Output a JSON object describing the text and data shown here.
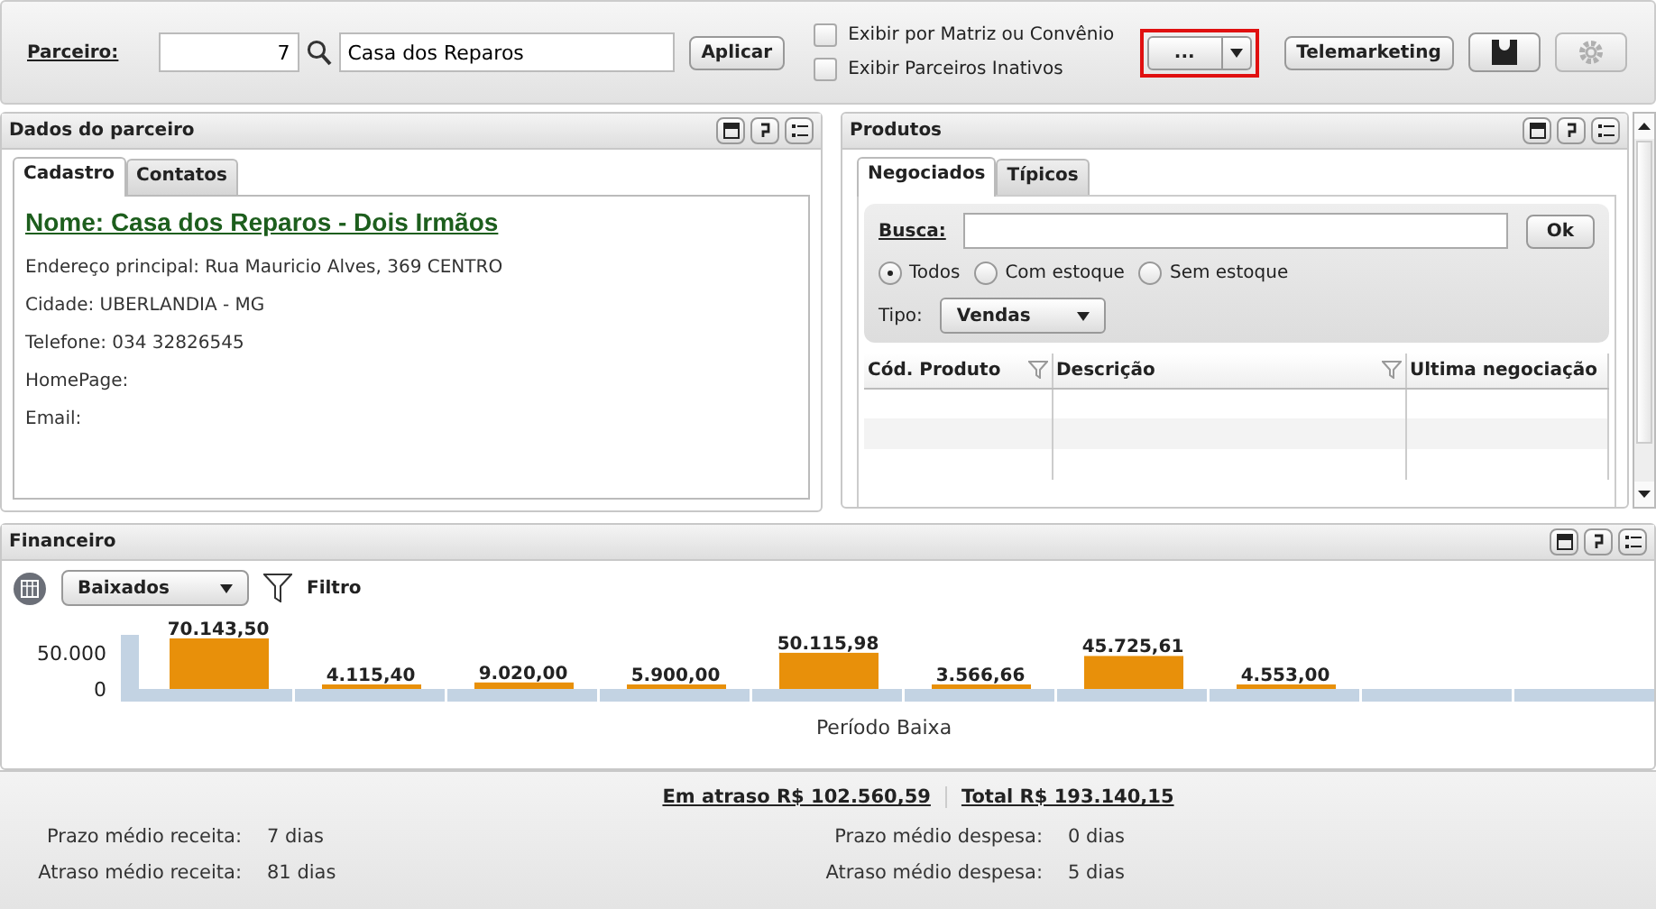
{
  "toolbar": {
    "partner_label": "Parceiro:",
    "partner_code": "7",
    "partner_name": "Casa dos Reparos",
    "apply_button": "Aplicar",
    "options": [
      {
        "label": "Exibir por Matriz ou Convênio",
        "checked": false
      },
      {
        "label": "Exibir Parceiros Inativos",
        "checked": false
      }
    ],
    "more_button": {
      "label": "...",
      "highlighted": true
    },
    "telemarketing_button": "Telemarketing"
  },
  "partner_panel": {
    "title": "Dados do parceiro",
    "tabs": [
      {
        "label": "Cadastro",
        "selected": true
      },
      {
        "label": "Contatos",
        "selected": false
      }
    ],
    "name": "Nome: Casa dos Reparos - Dois Irmãos",
    "fields": [
      "Endereço principal: Rua Mauricio Alves, 369 CENTRO",
      "Cidade: UBERLANDIA - MG",
      "Telefone: 034 32826545",
      "HomePage:",
      "Email:"
    ]
  },
  "products_panel": {
    "title": "Produtos",
    "tabs": [
      {
        "label": "Negociados",
        "selected": true
      },
      {
        "label": "Típicos",
        "selected": false
      }
    ],
    "search_label": "Busca:",
    "ok_button": "Ok",
    "stock_filter": [
      {
        "label": "Todos",
        "selected": true
      },
      {
        "label": "Com estoque",
        "selected": false
      },
      {
        "label": "Sem estoque",
        "selected": false
      }
    ],
    "type_label": "Tipo:",
    "type_value": "Vendas",
    "columns": [
      "Cód. Produto",
      "Descrição",
      "Ultima negociação"
    ]
  },
  "finance_panel": {
    "title": "Financeiro",
    "status_value": "Baixados",
    "filter_label": "Filtro",
    "chart_data": {
      "type": "bar",
      "xlabel": "Período Baixa",
      "ylim": [
        0,
        75000
      ],
      "categories": [
        null,
        null,
        null,
        null,
        null,
        null,
        null,
        null
      ],
      "yticks": [
        {
          "value": 0,
          "label": "0"
        },
        {
          "value": 50000,
          "label": "50.000"
        }
      ],
      "series": [
        {
          "color": "#e8900a",
          "values": [
            70143.5,
            4115.4,
            9020,
            5900,
            50115.98,
            3566.66,
            45725.61,
            4553
          ]
        }
      ],
      "value_labels": [
        "70.143,50",
        "4.115,40",
        "9.020,00",
        "5.900,00",
        "50.115,98",
        "3.566,66",
        "45.725,61",
        "4.553,00"
      ]
    }
  },
  "summary": {
    "overdue": "Em atraso R$ 102.560,59",
    "total": "Total R$ 193.140,15",
    "stats": [
      {
        "label": "Prazo médio receita:",
        "value": "7 dias"
      },
      {
        "label": "Prazo médio despesa:",
        "value": "0 dias"
      },
      {
        "label": "Atraso médio receita:",
        "value": "81 dias"
      },
      {
        "label": "Atraso médio despesa:",
        "value": "5 dias"
      }
    ]
  }
}
